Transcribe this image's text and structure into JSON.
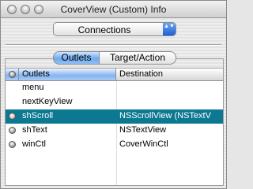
{
  "window": {
    "title": "CoverView (Custom) Info"
  },
  "popup": {
    "selected": "Connections",
    "arrows": "▲▼"
  },
  "tabs": [
    {
      "label": "Outlets",
      "selected": true
    },
    {
      "label": "Target/Action",
      "selected": false
    }
  ],
  "table": {
    "columns": [
      "Outlets",
      "Destination"
    ],
    "rows": [
      {
        "name": "menu",
        "destination": "",
        "connected": false,
        "selected": false
      },
      {
        "name": "nextKeyView",
        "destination": "",
        "connected": false,
        "selected": false
      },
      {
        "name": "shScroll",
        "destination": "NSScrollView (NSTextV",
        "connected": true,
        "selected": true
      },
      {
        "name": "shText",
        "destination": "NSTextView",
        "connected": true,
        "selected": false
      },
      {
        "name": "winCtl",
        "destination": "CoverWinCtl",
        "connected": true,
        "selected": false
      }
    ]
  },
  "colors": {
    "selection": "#0c7891",
    "accent": "#1f5fd8"
  }
}
